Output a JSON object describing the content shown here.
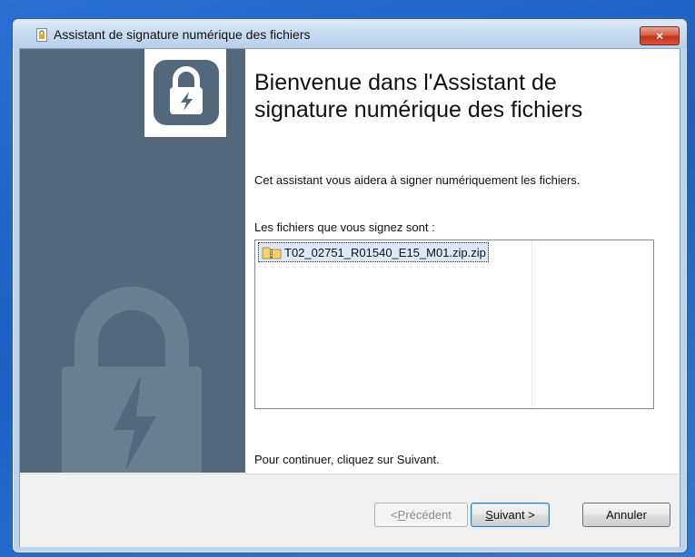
{
  "window": {
    "title": "Assistant de signature numérique des fichiers",
    "close_label": "×"
  },
  "content": {
    "heading": "Bienvenue dans l'Assistant de signature numérique des fichiers",
    "intro": "Cet assistant vous aidera à signer numériquement les fichiers.",
    "files_label": "Les fichiers que vous signez sont :",
    "files": [
      {
        "name": "T02_02751_R01540_E15_M01.zip.zip",
        "icon": "zip-folder-icon"
      }
    ],
    "continue_text": "Pour continuer, cliquez sur Suivant."
  },
  "footer": {
    "prev": {
      "prefix": "< ",
      "accel": "P",
      "rest": "récédent"
    },
    "next": {
      "accel": "S",
      "rest": "uivant >"
    },
    "cancel": "Annuler"
  },
  "colors": {
    "side_panel": "#53697b",
    "lock_icon": "#53697b",
    "big_lock": "#6a7f90"
  }
}
